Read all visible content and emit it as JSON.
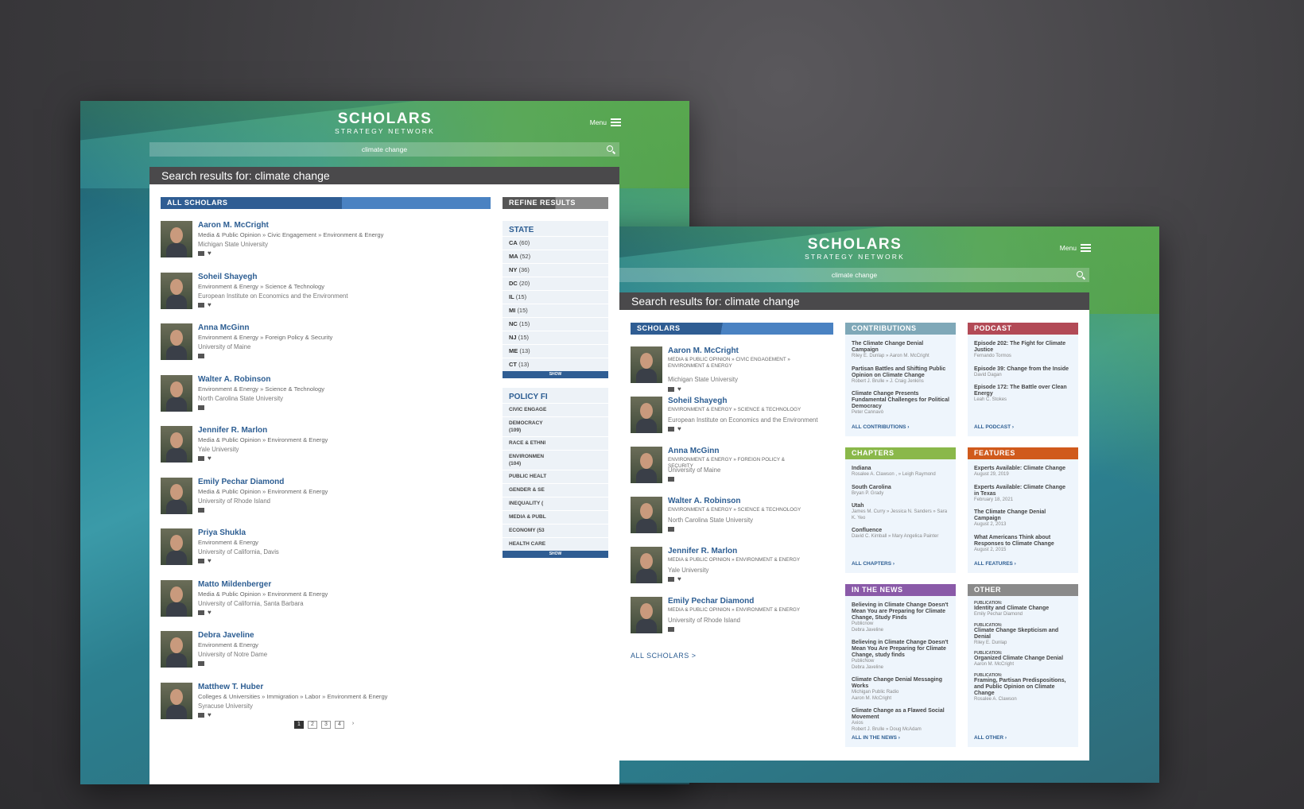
{
  "site": {
    "logo_main": "SCHOLARS",
    "logo_sub": "STRATEGY NETWORK",
    "menu_label": "Menu",
    "search_value": "climate change",
    "results_title": "Search results for: climate change"
  },
  "colors": {
    "scholars": "#2f5d93",
    "contributions": "#7fa8b8",
    "podcast": "#b24a56",
    "chapters": "#8ab84a",
    "features": "#d05a1c",
    "news": "#8a5aa8",
    "other": "#8a8a8a",
    "link": "#2c5d92"
  },
  "back": {
    "section_title": "ALL SCHOLARS",
    "refine_title": "REFINE RESULTS",
    "state_title": "STATE",
    "states": [
      {
        "label": "CA",
        "count": "(60)"
      },
      {
        "label": "MA",
        "count": "(52)"
      },
      {
        "label": "NY",
        "count": "(36)"
      },
      {
        "label": "DC",
        "count": "(20)"
      },
      {
        "label": "IL",
        "count": "(15)"
      },
      {
        "label": "MI",
        "count": "(15)"
      },
      {
        "label": "NC",
        "count": "(15)"
      },
      {
        "label": "NJ",
        "count": "(15)"
      },
      {
        "label": "ME",
        "count": "(13)"
      },
      {
        "label": "CT",
        "count": "(13)"
      }
    ],
    "show_more": "SHOW",
    "policy_title": "POLICY FI",
    "policies": [
      {
        "label": "CIVIC ENGAGE",
        "count": ""
      },
      {
        "label": "DEMOCRACY",
        "count": "(109)"
      },
      {
        "label": "RACE & ETHNI",
        "count": ""
      },
      {
        "label": "ENVIRONMEN",
        "count": "(104)"
      },
      {
        "label": "PUBLIC HEALT",
        "count": ""
      },
      {
        "label": "GENDER & SE",
        "count": ""
      },
      {
        "label": "INEQUALITY (",
        "count": ""
      },
      {
        "label": "MEDIA & PUBL",
        "count": ""
      },
      {
        "label": "ECONOMY (53",
        "count": ""
      },
      {
        "label": "HEALTH CARE",
        "count": ""
      }
    ],
    "scholars": [
      {
        "name": "Aaron M. McCright",
        "tags": "Media & Public Opinion » Civic Engagement » Environment & Energy",
        "univ": "Michigan State University",
        "twitter": true
      },
      {
        "name": "Soheil Shayegh",
        "tags": "Environment & Energy » Science & Technology",
        "univ": "European Institute on Economics and the Environment",
        "twitter": true
      },
      {
        "name": "Anna McGinn",
        "tags": "Environment & Energy » Foreign Policy & Security",
        "univ": "University of Maine",
        "twitter": false
      },
      {
        "name": "Walter A. Robinson",
        "tags": "Environment & Energy » Science & Technology",
        "univ": "North Carolina State University",
        "twitter": false
      },
      {
        "name": "Jennifer R. Marlon",
        "tags": "Media & Public Opinion » Environment & Energy",
        "univ": "Yale University",
        "twitter": true
      },
      {
        "name": "Emily Pechar Diamond",
        "tags": "Media & Public Opinion » Environment & Energy",
        "univ": "University of Rhode Island",
        "twitter": false
      },
      {
        "name": "Priya Shukla",
        "tags": "Environment & Energy",
        "univ": "University of California, Davis",
        "twitter": true
      },
      {
        "name": "Matto Mildenberger",
        "tags": "Media & Public Opinion » Environment & Energy",
        "univ": "University of California, Santa Barbara",
        "twitter": true
      },
      {
        "name": "Debra Javeline",
        "tags": "Environment & Energy",
        "univ": "University of Notre Dame",
        "twitter": false
      },
      {
        "name": "Matthew T. Huber",
        "tags": "Colleges & Universities » Immigration » Labor » Environment & Energy",
        "univ": "Syracuse University",
        "twitter": true
      }
    ],
    "pages": [
      "1",
      "2",
      "3",
      "4",
      "›"
    ]
  },
  "front": {
    "scholars_title": "SCHOLARS",
    "scholars": [
      {
        "name": "Aaron M. McCright",
        "tags": "MEDIA & PUBLIC OPINION » CIVIC ENGAGEMENT » ENVIRONMENT & ENERGY",
        "univ": "Michigan State University",
        "twitter": true
      },
      {
        "name": "Soheil Shayegh",
        "tags": "ENVIRONMENT & ENERGY » SCIENCE & TECHNOLOGY",
        "univ": "European Institute on Economics and the Environment",
        "twitter": true
      },
      {
        "name": "Anna McGinn",
        "tags": "ENVIRONMENT & ENERGY » FOREIGN POLICY & SECURITY",
        "univ": "University of Maine",
        "twitter": false
      },
      {
        "name": "Walter A. Robinson",
        "tags": "ENVIRONMENT & ENERGY » SCIENCE & TECHNOLOGY",
        "univ": "North Carolina State University",
        "twitter": false
      },
      {
        "name": "Jennifer R. Marlon",
        "tags": "MEDIA & PUBLIC OPINION » ENVIRONMENT & ENERGY",
        "univ": "Yale University",
        "twitter": true
      },
      {
        "name": "Emily Pechar Diamond",
        "tags": "MEDIA & PUBLIC OPINION » ENVIRONMENT & ENERGY",
        "univ": "University of Rhode Island",
        "twitter": false
      }
    ],
    "all_scholars": "ALL SCHOLARS >",
    "boxes": [
      {
        "key": "contributions",
        "title": "CONTRIBUTIONS",
        "all": "ALL CONTRIBUTIONS ›",
        "items": [
          {
            "t": "The Climate Change Denial Campaign",
            "s": [
              "Riley E. Dunlap » Aaron M. McCright"
            ]
          },
          {
            "t": "Partisan Battles and Shifting Public Opinion on Climate Change",
            "s": [
              "Robert J. Brulle » J. Craig Jenkins"
            ]
          },
          {
            "t": "Climate Change Presents Fundamental Challenges for Political Democracy",
            "s": [
              "Peter Cannavò"
            ]
          }
        ]
      },
      {
        "key": "podcast",
        "title": "PODCAST",
        "all": "ALL PODCAST ›",
        "items": [
          {
            "t": "Episode 202: The Fight for Climate Justice",
            "s": [
              "Fernando Tormos"
            ]
          },
          {
            "t": "Episode 39: Change from the Inside",
            "s": [
              "David Dagan"
            ]
          },
          {
            "t": "Episode 172: The Battle over Clean Energy",
            "s": [
              "Leah C. Stokes"
            ]
          }
        ]
      },
      {
        "key": "chapters",
        "title": "CHAPTERS",
        "all": "ALL CHAPTERS ›",
        "items": [
          {
            "t": "Indiana",
            "s": [
              "Rosalee A. Clawson , » Leigh Raymond"
            ]
          },
          {
            "t": "South Carolina",
            "s": [
              "Bryan P. Grady"
            ]
          },
          {
            "t": "Utah",
            "s": [
              "James M. Curry » Jessica N. Sanders » Sara K. Yeo"
            ]
          },
          {
            "t": "Confluence",
            "s": [
              "David C. Kimball » Mary Angelica Painter"
            ]
          }
        ]
      },
      {
        "key": "features",
        "title": "FEATURES",
        "all": "ALL FEATURES ›",
        "items": [
          {
            "t": "Experts Available: Climate Change",
            "s": [
              "August 29, 2019"
            ]
          },
          {
            "t": "Experts Available: Climate Change in Texas",
            "s": [
              "February 18, 2021"
            ]
          },
          {
            "t": "The Climate Change Denial Campaign",
            "s": [
              "August 2, 2013"
            ]
          },
          {
            "t": "What Americans Think about Responses to Climate Change",
            "s": [
              "August 2, 2015"
            ]
          }
        ]
      },
      {
        "key": "news",
        "title": "IN THE NEWS",
        "all": "ALL IN THE NEWS ›",
        "items": [
          {
            "t": "Believing in Climate Change Doesn't Mean You are Preparing for Climate Change, Study Finds",
            "s": [
              "Publicnow",
              "Debra Javeline"
            ]
          },
          {
            "t": "Believing in Climate Change Doesn't Mean You Are Preparing for Climate Change, study finds",
            "s": [
              "PublicNow",
              "Debra Javeline"
            ]
          },
          {
            "t": "Climate Change Denial Messaging Works",
            "s": [
              "Michigan Public Radio",
              "Aaron M. McCright"
            ]
          },
          {
            "t": "Climate Change as a Flawed Social Movement",
            "s": [
              "Axios",
              "Robert J. Brulle » Doug McAdam"
            ]
          }
        ]
      },
      {
        "key": "other",
        "title": "OTHER",
        "all": "ALL OTHER ›",
        "items": [
          {
            "p": "PUBLICATION:",
            "t": "Identity and Climate Change",
            "s": [
              "Emily Pechar Diamond"
            ]
          },
          {
            "p": "PUBLICATION:",
            "t": "Climate Change Skepticism and Denial",
            "s": [
              "Riley E. Dunlap"
            ]
          },
          {
            "p": "PUBLICATION:",
            "t": "Organized Climate Change Denial",
            "s": [
              "Aaron M. McCright"
            ]
          },
          {
            "p": "PUBLICATION:",
            "t": "Framing, Partisan Predispositions, and Public Opinion on Climate Change",
            "s": [
              "Rosalee A. Clawson"
            ]
          }
        ]
      }
    ]
  }
}
